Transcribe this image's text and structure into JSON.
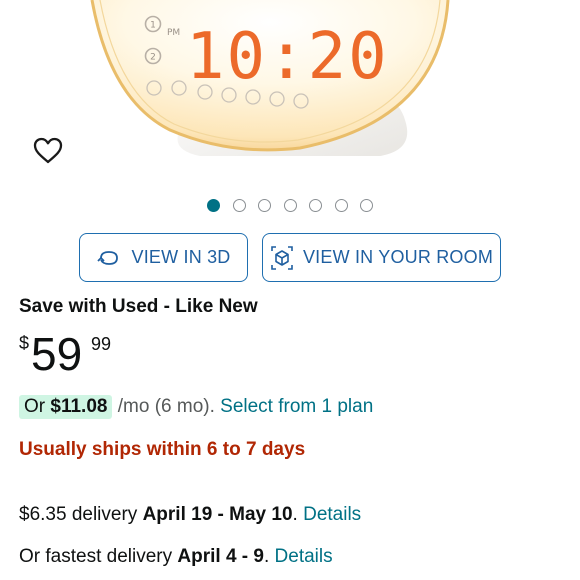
{
  "product": {
    "clock_period": "PM",
    "clock_time": "10:20",
    "alarm_1": "1",
    "alarm_2": "2"
  },
  "carousel": {
    "count": 7,
    "active_index": 0
  },
  "buttons": {
    "view_3d": "VIEW IN 3D",
    "view_room": "VIEW IN YOUR ROOM"
  },
  "condition": "Save with Used - Like New",
  "price": {
    "symbol": "$",
    "whole": "59",
    "fraction": "99"
  },
  "monthly": {
    "prefix": "Or ",
    "amount": "$11.08",
    "suffix": " /mo (6 mo). ",
    "link": "Select from 1 plan"
  },
  "shipping_note": "Usually ships within 6 to 7 days",
  "delivery": {
    "standard_prefix": "$6.35 delivery ",
    "standard_dates": "April 19 - May 10",
    "standard_sep": ". ",
    "standard_link": "Details",
    "fast_prefix": "Or fastest delivery ",
    "fast_dates": "April 4 - 9",
    "fast_sep": ". ",
    "fast_link": "Details"
  },
  "colors": {
    "link": "#007185",
    "button_border": "#1f6fb0",
    "shipping": "#b12704",
    "clock_digits": "#ec6a2a",
    "pill_bg": "#cff5e3"
  },
  "icons": {
    "wishlist": "heart-outline-icon",
    "view_3d": "rotate-3d-icon",
    "view_room": "ar-cube-icon"
  }
}
